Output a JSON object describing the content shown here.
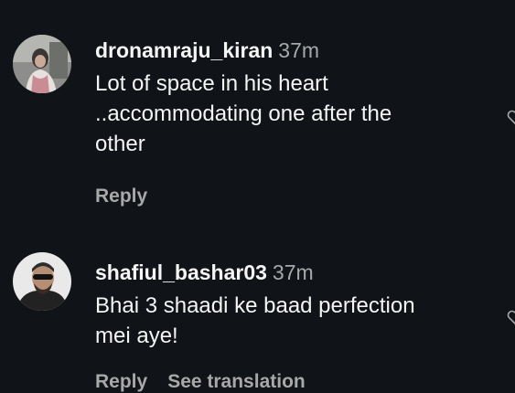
{
  "comments": [
    {
      "username": "dronamraju_kiran",
      "time": "37m",
      "text": "Lot of space in his heart\n..accommodating one after the\nother",
      "actions": [
        "Reply"
      ]
    },
    {
      "username": "shafiul_bashar03",
      "time": "37m",
      "text": "Bhai 3 shaadi ke baad perfection\nmei aye!",
      "actions": [
        "Reply",
        "See translation"
      ]
    }
  ],
  "icons": {
    "like": "heart-icon"
  },
  "colors": {
    "background": "#101317",
    "primary_text": "#f5f5f5",
    "secondary_text": "#a8a8a8"
  }
}
